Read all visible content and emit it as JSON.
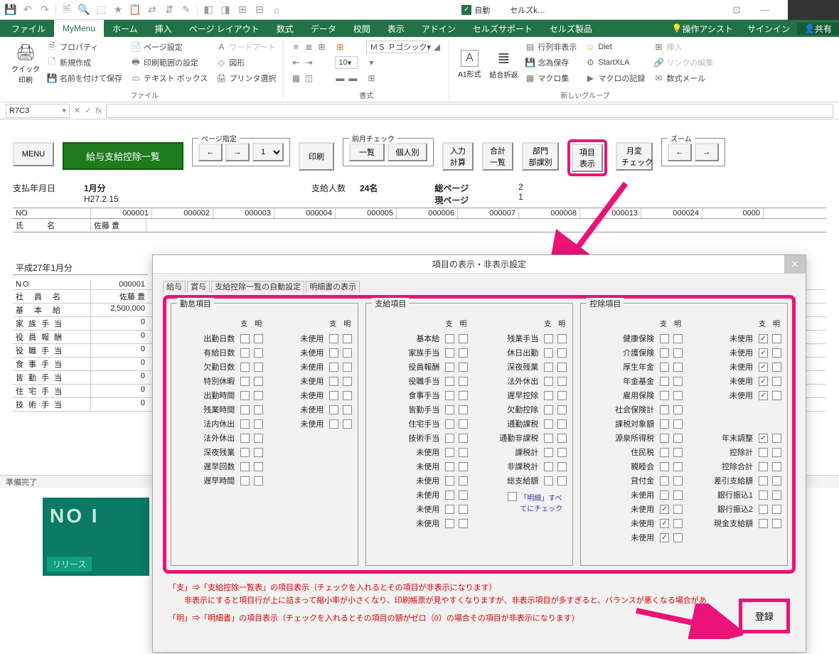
{
  "titlebar": {
    "autosave_label": "自動",
    "doc_name": "セルズk…"
  },
  "ribbon_tabs": [
    "ファイル",
    "MyMenu",
    "ホーム",
    "挿入",
    "ページ レイアウト",
    "数式",
    "データ",
    "校閲",
    "表示",
    "アドイン",
    "セルズサポート",
    "セルズ製品"
  ],
  "ribbon_right": {
    "assist": "操作アシスト",
    "signin": "サインイン",
    "share": "共有"
  },
  "ribbon": {
    "quickprint": "クイック\n印刷",
    "file_group": "ファイル",
    "items_file": [
      "プロパティ",
      "新規作成",
      "名前を付けて保存",
      "ページ設定",
      "印刷範囲の設定",
      "テキスト ボックス",
      "ワードアート",
      "図形",
      "プリンタ選択"
    ],
    "format_group": "書式",
    "font_name": "ＭＳ Ｐゴシック",
    "font_size": "10",
    "a1": "A1形式",
    "merge": "結合折返",
    "row_hide": "行列非表示",
    "backup": "念為保存",
    "macro": "マクロ集",
    "diet": "Diet",
    "startxla": "StartXLA",
    "macro_rec": "マクロの記録",
    "insert": "挿入",
    "link_edit": "リンクの編集",
    "mail": "数式メール",
    "new_group": "新しいグループ"
  },
  "namebox": "R7C3",
  "sheet": {
    "menu": "MENU",
    "green": "給与支給控除一覧",
    "page_spec": "ページ指定",
    "prev_month": "前月チェック",
    "print": "印刷",
    "list": "一覧",
    "individual": "個人別",
    "btns": [
      "入力\n計算",
      "合計\n一覧",
      "部門\n部課別",
      "項目\n表示",
      "月変\nチェック"
    ],
    "zoom": "ズーム",
    "pay_date_lbl": "支払年月日",
    "month": "1月分",
    "date": "H27.2.15",
    "pay_count_lbl": "支給人数",
    "pay_count": "24名",
    "total_page_lbl": "総ページ",
    "total_page": "2",
    "cur_page_lbl": "現ページ",
    "cur_page": "1",
    "cols": [
      "NO",
      "000001",
      "000002",
      "000003",
      "000004",
      "000005",
      "000006",
      "000007",
      "000008",
      "000013",
      "000024",
      "0000"
    ],
    "name_row_lbl": "氏　　　名",
    "name_row_val": "佐藤 豊",
    "period": "平成27年1月分",
    "rows": [
      {
        "l": "NO",
        "v": "000001"
      },
      {
        "l": "社　員　名",
        "v": "佐藤 豊"
      },
      {
        "l": "基　本　給",
        "v": "2,500,000"
      },
      {
        "l": "家 族 手 当",
        "v": "0"
      },
      {
        "l": "役 員 報 酬",
        "v": "0"
      },
      {
        "l": "役 職 手 当",
        "v": "0"
      },
      {
        "l": "食 事 手 当",
        "v": "0"
      },
      {
        "l": "皆 勤 手 当",
        "v": "0"
      },
      {
        "l": "住 宅 手 当",
        "v": "0"
      },
      {
        "l": "技 術 手 当",
        "v": "0"
      }
    ]
  },
  "statusbar": "準備完了",
  "release": {
    "top": "NO I",
    "tag": "リリース"
  },
  "dialog": {
    "title": "項目の表示・非表示設定",
    "tabs": [
      "給与",
      "賞与",
      "支給控除一覧の自動設定",
      "明細書の表示"
    ],
    "group_labels": [
      "勤怠項目",
      "支給項目",
      "控除項目"
    ],
    "col_hdr": [
      "支",
      "明"
    ],
    "kintai_a": [
      "出勤日数",
      "有給日数",
      "欠勤日数",
      "特別休暇",
      "出勤時間",
      "残業時間",
      "法内休出",
      "法外休出",
      "深夜残業",
      "遅早回数",
      "遅早時間"
    ],
    "kintai_b": [
      "未使用",
      "未使用",
      "未使用",
      "未使用",
      "未使用",
      "未使用",
      "未使用"
    ],
    "shikyu_a": [
      "基本給",
      "家族手当",
      "役員報酬",
      "役職手当",
      "食事手当",
      "皆勤手当",
      "住宅手当",
      "技術手当",
      "未使用",
      "未使用",
      "未使用",
      "未使用",
      "未使用",
      "未使用"
    ],
    "shikyu_b": [
      "残業手当",
      "休日出勤",
      "深夜残業",
      "法外休出",
      "遅早控除",
      "欠勤控除",
      "通勤課税",
      "通勤非課税",
      "課税計",
      "非課税計",
      "総支給額"
    ],
    "meisai_all": "「明細」すべてにチェック",
    "koujo_a": [
      "健康保険",
      "介護保険",
      "厚生年金",
      "年金基金",
      "雇用保険",
      "社会保険計",
      "課税対象額",
      "源泉所得税",
      "住民税",
      "親睦会",
      "貸付金",
      "未使用",
      "未使用",
      "未使用",
      "未使用"
    ],
    "koujo_a_checked": [
      false,
      false,
      false,
      false,
      false,
      false,
      false,
      false,
      false,
      false,
      false,
      false,
      true,
      true,
      true
    ],
    "koujo_b": [
      "未使用",
      "未使用",
      "未使用",
      "未使用",
      "未使用",
      "",
      "",
      "年末調整",
      "控除計",
      "控除合計",
      "差引支給額",
      "銀行振込1",
      "銀行振込2",
      "現金支給額"
    ],
    "koujo_b_checked": [
      true,
      true,
      true,
      true,
      true,
      null,
      null,
      true,
      false,
      false,
      false,
      false,
      false,
      false
    ],
    "explain1": "「支」⇒「支給控除一覧表」の項目表示（チェックを入れるとその項目が非表示になります）",
    "explain2": "　　非表示にすると項目行が上に詰まって縮小率が小さくなり、印刷帳票が見やすくなりますが、非表示項目が多すぎると、バランスが悪くなる場合があ",
    "explain3": "「明」⇒「明細書」の項目表示（チェックを入れるとその項目の額がゼロ（0）の場合その項目が非表示になります）",
    "register": "登録"
  }
}
